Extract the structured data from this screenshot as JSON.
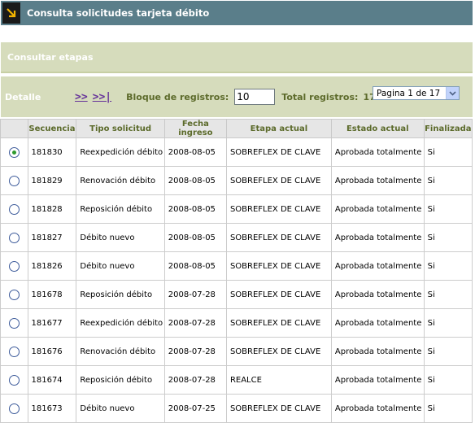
{
  "header": {
    "title": "Consulta solicitudes tarjeta débito",
    "icon": "arrow-down-right-icon"
  },
  "section": {
    "title": "Consultar etapas"
  },
  "toolbar": {
    "detalle": "Detalle",
    "next": ">>",
    "last": ">>|",
    "bloque_label": "Bloque de registros:",
    "bloque_value": "10",
    "total_label": "Total registros:",
    "total_value": "170",
    "pagina": "Pagina 1 de 17"
  },
  "table": {
    "columns": [
      "",
      "Secuencia",
      "Tipo solicitud",
      "Fecha ingreso",
      "Etapa actual",
      "Estado actual",
      "Finalizada"
    ],
    "rows": [
      {
        "selected": true,
        "cells": [
          "181830",
          "Reexpedición débito",
          "2008-08-05",
          "SOBREFLEX DE CLAVE",
          "Aprobada totalmente",
          "Si"
        ]
      },
      {
        "selected": false,
        "cells": [
          "181829",
          "Renovación débito",
          "2008-08-05",
          "SOBREFLEX DE CLAVE",
          "Aprobada totalmente",
          "Si"
        ]
      },
      {
        "selected": false,
        "cells": [
          "181828",
          "Reposición débito",
          "2008-08-05",
          "SOBREFLEX DE CLAVE",
          "Aprobada totalmente",
          "Si"
        ]
      },
      {
        "selected": false,
        "cells": [
          "181827",
          "Débito nuevo",
          "2008-08-05",
          "SOBREFLEX DE CLAVE",
          "Aprobada totalmente",
          "Si"
        ]
      },
      {
        "selected": false,
        "cells": [
          "181826",
          "Débito nuevo",
          "2008-08-05",
          "SOBREFLEX DE CLAVE",
          "Aprobada totalmente",
          "Si"
        ]
      },
      {
        "selected": false,
        "cells": [
          "181678",
          "Reposición débito",
          "2008-07-28",
          "SOBREFLEX DE CLAVE",
          "Aprobada totalmente",
          "Si"
        ]
      },
      {
        "selected": false,
        "cells": [
          "181677",
          "Reexpedición débito",
          "2008-07-28",
          "SOBREFLEX DE CLAVE",
          "Aprobada totalmente",
          "Si"
        ]
      },
      {
        "selected": false,
        "cells": [
          "181676",
          "Renovación débito",
          "2008-07-28",
          "SOBREFLEX DE CLAVE",
          "Aprobada totalmente",
          "Si"
        ]
      },
      {
        "selected": false,
        "cells": [
          "181674",
          "Reposición débito",
          "2008-07-28",
          "REALCE",
          "Aprobada totalmente",
          "Si"
        ]
      },
      {
        "selected": false,
        "cells": [
          "181673",
          "Débito nuevo",
          "2008-07-25",
          "SOBREFLEX DE CLAVE",
          "Aprobada totalmente",
          "Si"
        ]
      }
    ]
  }
}
